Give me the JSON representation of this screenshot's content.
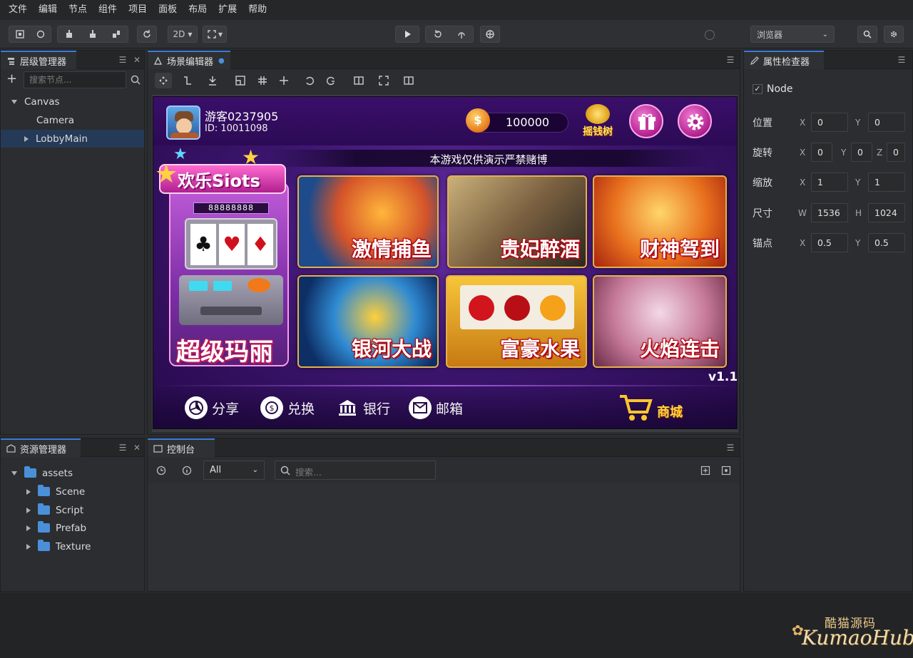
{
  "menu": [
    "文件",
    "编辑",
    "节点",
    "组件",
    "项目",
    "面板",
    "布局",
    "扩展",
    "帮助"
  ],
  "toolbar": {
    "mode": "2D",
    "preview_target": "浏览器"
  },
  "hierarchy": {
    "title": "层级管理器",
    "search_placeholder": "搜索节点...",
    "nodes": [
      {
        "label": "Canvas"
      },
      {
        "label": "Camera"
      },
      {
        "label": "LobbyMain"
      }
    ]
  },
  "scene": {
    "title": "场景编辑器"
  },
  "game": {
    "player_name": "游客0237905",
    "player_id": "ID: 10011098",
    "coins": "100000",
    "money_tree_label": "摇钱树",
    "notice": "本游戏仅供演示严禁赌博",
    "slots_title": "欢乐Siots",
    "slots_counter": "88888888",
    "slots_name": "超级玛丽",
    "games": [
      "激情捕鱼",
      "贵妃醉酒",
      "财神驾到",
      "银河大战",
      "富豪水果",
      "火焰连击"
    ],
    "version": "v1.1",
    "nav": [
      "分享",
      "兑换",
      "银行",
      "邮箱"
    ],
    "shop_label": "商城"
  },
  "inspector": {
    "title": "属性检查器",
    "node_label": "Node",
    "node_checked": true,
    "rows": [
      {
        "label": "位置",
        "fields": [
          {
            "axis": "X",
            "value": "0"
          },
          {
            "axis": "Y",
            "value": "0"
          }
        ]
      },
      {
        "label": "旋转",
        "fields": [
          {
            "axis": "X",
            "value": "0"
          },
          {
            "axis": "Y",
            "value": "0"
          },
          {
            "axis": "Z",
            "value": "0"
          }
        ]
      },
      {
        "label": "缩放",
        "fields": [
          {
            "axis": "X",
            "value": "1"
          },
          {
            "axis": "Y",
            "value": "1"
          }
        ]
      },
      {
        "label": "尺寸",
        "fields": [
          {
            "axis": "W",
            "value": "1536"
          },
          {
            "axis": "H",
            "value": "1024"
          }
        ]
      },
      {
        "label": "锚点",
        "fields": [
          {
            "axis": "X",
            "value": "0.5"
          },
          {
            "axis": "Y",
            "value": "0.5"
          }
        ]
      }
    ]
  },
  "assets": {
    "title": "资源管理器",
    "root": "assets",
    "folders": [
      "Scene",
      "Script",
      "Prefab",
      "Texture"
    ]
  },
  "console": {
    "title": "控制台",
    "filter": "All",
    "search_placeholder": "搜索..."
  },
  "watermark": {
    "cn": "酷猫源码",
    "en": "KumaoHub"
  },
  "colors": {
    "accent": "#3d7bd6",
    "gold": "#e6b04a"
  }
}
